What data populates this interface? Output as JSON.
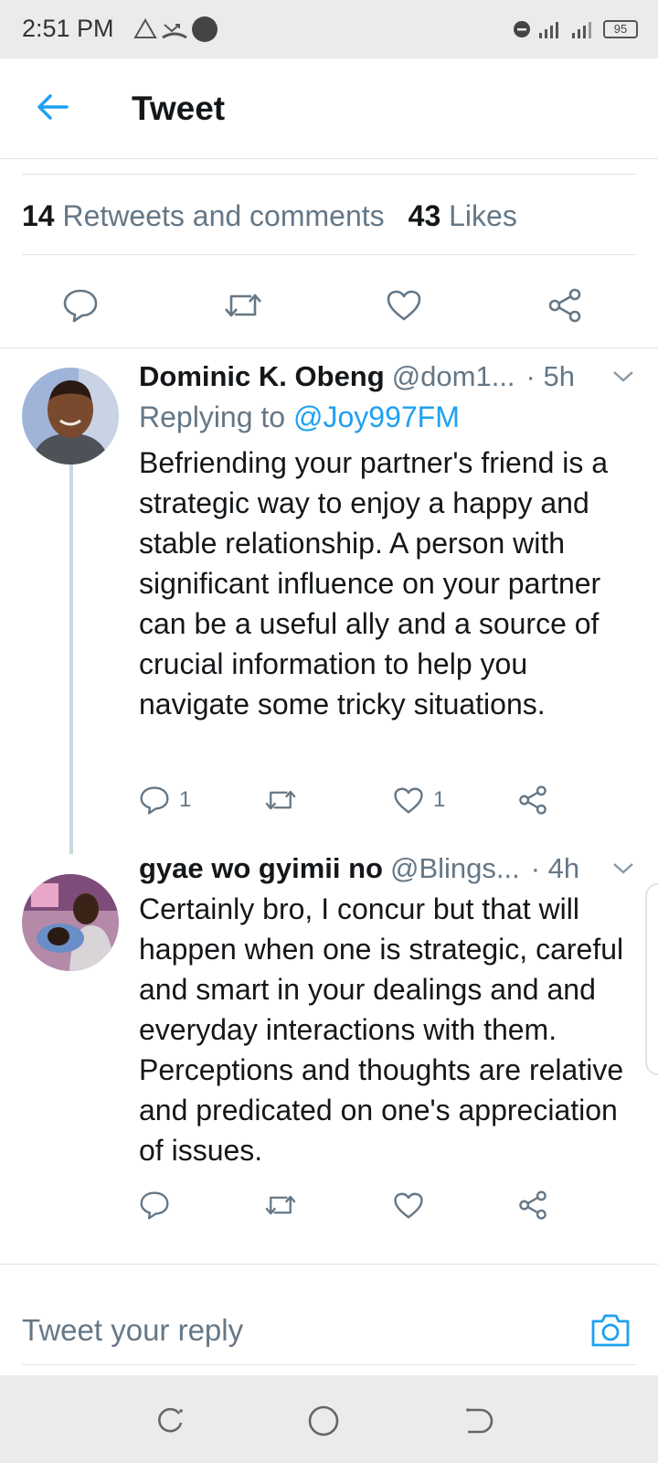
{
  "status_bar": {
    "time": "2:51 PM",
    "battery": "95",
    "icons": [
      "alert-triangle-icon",
      "missed-call-icon",
      "circle-icon",
      "do-not-disturb-icon",
      "signal-icon",
      "signal-icon",
      "battery-icon"
    ]
  },
  "app_bar": {
    "title": "Tweet",
    "back_icon": "arrow-left-icon"
  },
  "stats": {
    "retweets_count": "14",
    "retweets_label": "Retweets and comments",
    "likes_count": "43",
    "likes_label": "Likes"
  },
  "main_actions": [
    "comment-icon",
    "retweet-icon",
    "heart-icon",
    "share-icon"
  ],
  "replies": [
    {
      "name": "Dominic K. Obeng",
      "handle": "@dom1...",
      "time": "· 5h",
      "replying_to_label": "Replying to",
      "replying_to_handle": "@Joy997FM",
      "text": "Befriending your partner's friend is a strategic way to enjoy a happy and stable relationship. A person with significant influence on your partner can be a useful ally and a source of crucial information to help you navigate some tricky situations.",
      "reply_count": "1",
      "like_count": "1"
    },
    {
      "name": "gyae wo gyimii no",
      "handle": "@Blings...",
      "time": "· 4h",
      "text": "Certainly bro, I concur but that will happen when one is strategic, careful and smart in your dealings and and everyday interactions with them. Perceptions and thoughts are relative and predicated on one's appreciation of issues.",
      "reply_count": "",
      "like_count": ""
    }
  ],
  "composer": {
    "placeholder": "Tweet your reply"
  },
  "colors": {
    "accent": "#1da1f2",
    "text_primary": "#14171a",
    "text_secondary": "#657786",
    "divider": "#dfe3e6"
  }
}
